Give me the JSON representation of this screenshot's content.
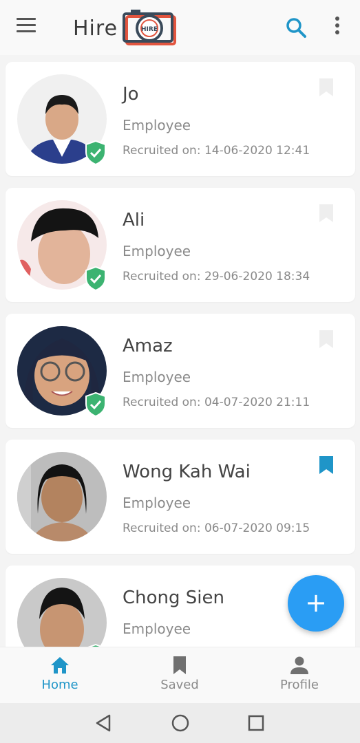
{
  "app": {
    "brand": "Hire",
    "logo_text": "HIRE",
    "accent_color": "#1f95c8",
    "fab_color": "#2a9df4",
    "verified_color": "#3cb371"
  },
  "header": {
    "menu_icon": "hamburger-icon",
    "search_icon": "search-icon",
    "more_icon": "more-vert-icon"
  },
  "employees": [
    {
      "name": "Jo",
      "role": "Employee",
      "recruited": "Recruited on: 14-06-2020 12:41",
      "verified": true,
      "saved": false
    },
    {
      "name": "Ali",
      "role": "Employee",
      "recruited": "Recruited on: 29-06-2020 18:34",
      "verified": true,
      "saved": false
    },
    {
      "name": "Amaz",
      "role": "Employee",
      "recruited": "Recruited on: 04-07-2020 21:11",
      "verified": true,
      "saved": false
    },
    {
      "name": "Wong Kah Wai",
      "role": "Employee",
      "recruited": "Recruited on: 06-07-2020 09:15",
      "verified": false,
      "saved": true
    },
    {
      "name": "Chong Sien",
      "role": "Employee",
      "recruited": "",
      "verified": true,
      "saved": false
    }
  ],
  "fab": {
    "label": "+"
  },
  "bottom_nav": {
    "items": [
      {
        "label": "Home",
        "icon": "home-icon",
        "active": true
      },
      {
        "label": "Saved",
        "icon": "bookmark-icon",
        "active": false
      },
      {
        "label": "Profile",
        "icon": "person-icon",
        "active": false
      }
    ]
  },
  "system_nav": {
    "back": "back-triangle-icon",
    "home": "home-circle-icon",
    "recents": "recents-square-icon"
  }
}
